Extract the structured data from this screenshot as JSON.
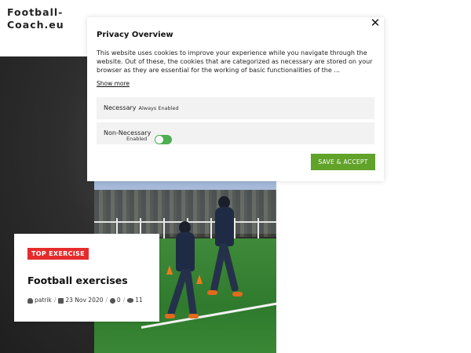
{
  "site": {
    "logo_line1": "Football-",
    "logo_line2": "Coach.eu"
  },
  "privacy": {
    "title": "Privacy Overview",
    "body": "This website uses cookies to improve your experience while you navigate through the website. Out of these, the cookies that are categorized as necessary are stored on your browser as they are essential for the working of basic functionalities of the ...",
    "show_more": "Show more",
    "close_label": "✕",
    "rows": [
      {
        "label": "Necessary",
        "status": "Always Enabled"
      },
      {
        "label": "Non-Necessary",
        "status": "Enabled",
        "toggle_on": true
      }
    ],
    "save_button": "SAVE & ACCEPT",
    "accent_color": "#61a229",
    "toggle_color": "#4caf50"
  },
  "post": {
    "category": "TOP EXERCISE",
    "category_color": "#e52b2b",
    "title": "Football exercises",
    "author": "patrik",
    "date": "23 Nov 2020",
    "comments": "0",
    "views": "11",
    "meta_sep": "/"
  }
}
